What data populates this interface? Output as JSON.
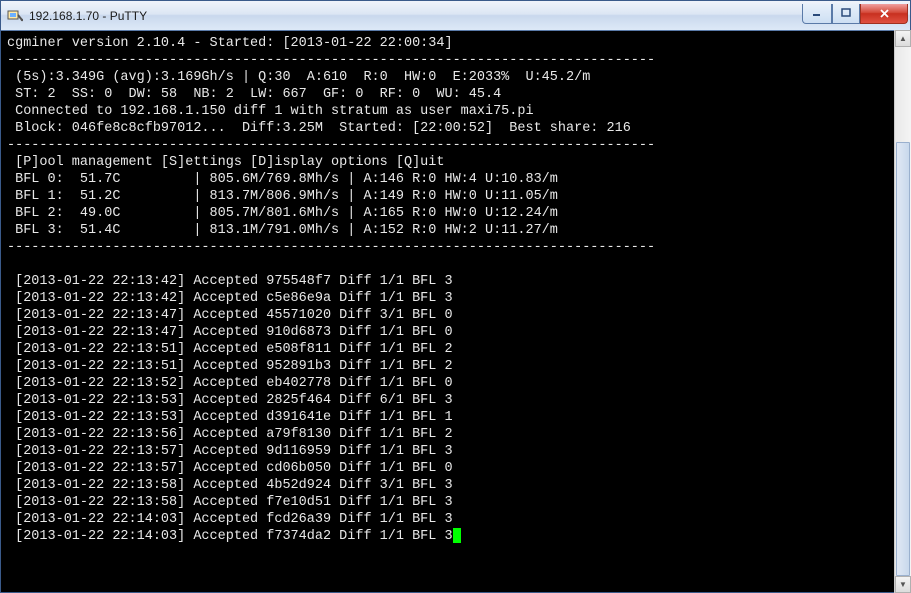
{
  "window": {
    "title": "192.168.1.70 - PuTTY"
  },
  "header": {
    "line": "cgminer version 2.10.4 - Started: [2013-01-22 22:00:34]"
  },
  "stats1": " (5s):3.349G (avg):3.169Gh/s | Q:30  A:610  R:0  HW:0  E:2033%  U:45.2/m",
  "stats2": " ST: 2  SS: 0  DW: 58  NB: 2  LW: 667  GF: 0  RF: 0  WU: 45.4",
  "stats3": " Connected to 192.168.1.150 diff 1 with stratum as user maxi75.pi",
  "stats4": " Block: 046fe8c8cfb97012...  Diff:3.25M  Started: [22:00:52]  Best share: 216",
  "menu": " [P]ool management [S]ettings [D]isplay options [Q]uit",
  "devices": [
    " BFL 0:  51.7C         | 805.6M/769.8Mh/s | A:146 R:0 HW:4 U:10.83/m",
    " BFL 1:  51.2C         | 813.7M/806.9Mh/s | A:149 R:0 HW:0 U:11.05/m",
    " BFL 2:  49.0C         | 805.7M/801.6Mh/s | A:165 R:0 HW:0 U:12.24/m",
    " BFL 3:  51.4C         | 813.1M/791.0Mh/s | A:152 R:0 HW:2 U:11.27/m"
  ],
  "log": [
    " [2013-01-22 22:13:42] Accepted 975548f7 Diff 1/1 BFL 3",
    " [2013-01-22 22:13:42] Accepted c5e86e9a Diff 1/1 BFL 3",
    " [2013-01-22 22:13:47] Accepted 45571020 Diff 3/1 BFL 0",
    " [2013-01-22 22:13:47] Accepted 910d6873 Diff 1/1 BFL 0",
    " [2013-01-22 22:13:51] Accepted e508f811 Diff 1/1 BFL 2",
    " [2013-01-22 22:13:51] Accepted 952891b3 Diff 1/1 BFL 2",
    " [2013-01-22 22:13:52] Accepted eb402778 Diff 1/1 BFL 0",
    " [2013-01-22 22:13:53] Accepted 2825f464 Diff 6/1 BFL 3",
    " [2013-01-22 22:13:53] Accepted d391641e Diff 1/1 BFL 1",
    " [2013-01-22 22:13:56] Accepted a79f8130 Diff 1/1 BFL 2",
    " [2013-01-22 22:13:57] Accepted 9d116959 Diff 1/1 BFL 3",
    " [2013-01-22 22:13:57] Accepted cd06b050 Diff 1/1 BFL 0",
    " [2013-01-22 22:13:58] Accepted 4b52d924 Diff 3/1 BFL 3",
    " [2013-01-22 22:13:58] Accepted f7e10d51 Diff 1/1 BFL 3",
    " [2013-01-22 22:14:03] Accepted fcd26a39 Diff 1/1 BFL 3",
    " [2013-01-22 22:14:03] Accepted f7374da2 Diff 1/1 BFL 3"
  ],
  "dash": "--------------------------------------------------------------------------------"
}
